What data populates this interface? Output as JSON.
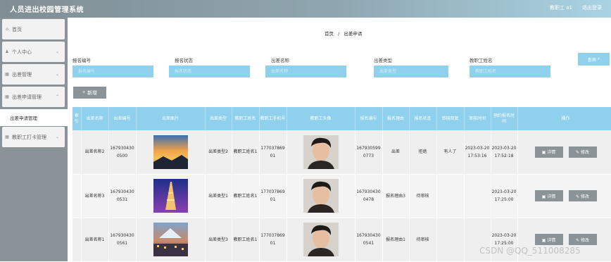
{
  "app": {
    "title": "人员进出校园管理系统",
    "user": "教职工 a1",
    "logout": "退出登录"
  },
  "sidebar": {
    "items": [
      {
        "label": "首页",
        "icon": "home-icon"
      },
      {
        "label": "个人中心",
        "icon": "user-icon"
      },
      {
        "label": "出差管理",
        "icon": "grid-icon"
      },
      {
        "label": "出差申请管理",
        "icon": "grid-icon"
      },
      {
        "label": "教职工打卡管理",
        "icon": "grid-icon"
      }
    ],
    "submenu": "出差申请管理"
  },
  "breadcrumb": {
    "home": "首页",
    "sep": "/",
    "current": "出差申请"
  },
  "filters": [
    {
      "label": "报名编号",
      "placeholder": "报名编号"
    },
    {
      "label": "报名状态",
      "placeholder": "报名状态"
    },
    {
      "label": "出差名称",
      "placeholder": "出差名称"
    },
    {
      "label": "出差类型",
      "placeholder": "出差类型"
    },
    {
      "label": "教职工姓名",
      "placeholder": "教职工姓名"
    }
  ],
  "search_label": "查询",
  "add_label": "新增",
  "table": {
    "headers": [
      "索引",
      "出差名称",
      "出差编号",
      "出差图片",
      "出差类型",
      "教职工姓名",
      "教职工手机号",
      "教职工头像",
      "报名编号",
      "报名理由",
      "报名状态",
      "审核回复",
      "审核时间",
      "预约报名时间",
      "操作"
    ],
    "rows": [
      {
        "idx": "",
        "name": "出差名称2",
        "no": "1679304300500",
        "type": "出差类型2",
        "tname": "教职工姓名1",
        "phone": "17703786901",
        "regno": "1679305990773",
        "reason": "出差",
        "status": "拒绝",
        "reply": "有人了",
        "time": "2023-03-20 17:53:16",
        "regtime": "2023-03-20 17:52:18",
        "img": "sunset"
      },
      {
        "idx": "",
        "name": "出差名称3",
        "no": "1679304300531",
        "type": "出差类型1",
        "tname": "教职工姓名1",
        "phone": "17703786901",
        "regno": "1679304300478",
        "reason": "报名理由3",
        "status": "待审核",
        "reply": "",
        "time": "",
        "regtime": "2023-03-20 17:25:00",
        "img": "tower"
      },
      {
        "idx": "",
        "name": "出差名称1",
        "no": "1679304300561",
        "type": "出差类型3",
        "tname": "教职工姓名1",
        "phone": "17703786901",
        "regno": "1679304300541",
        "reason": "报名理由1",
        "status": "待审核",
        "reply": "",
        "time": "",
        "regtime": "2023-03-20 17:25:00",
        "img": "city"
      }
    ],
    "detail_label": "详情",
    "edit_label": "修改"
  },
  "watermark": "CSDN @QQ_511008285",
  "colors": {
    "accent": "#8fd0ec",
    "sidebar": "#8a9398"
  }
}
